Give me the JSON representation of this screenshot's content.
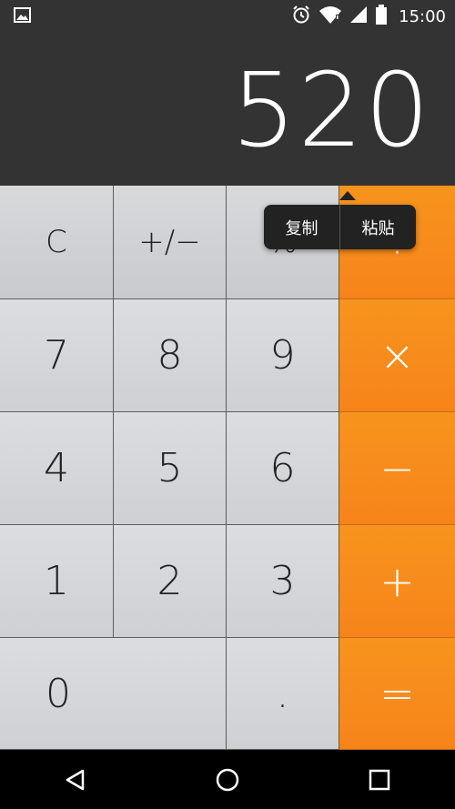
{
  "status_bar": {
    "time": "15:00",
    "icons": [
      "image-notification-icon",
      "alarm-icon",
      "wifi-icon",
      "signal-icon",
      "battery-icon"
    ]
  },
  "display": {
    "value": "520"
  },
  "popup": {
    "copy_label": "复制",
    "paste_label": "粘贴"
  },
  "keys": {
    "clear": "C",
    "plus_minus": "+∕−",
    "percent": "%",
    "divide": "÷",
    "seven": "7",
    "eight": "8",
    "nine": "9",
    "multiply": "×",
    "four": "4",
    "five": "5",
    "six": "6",
    "minus": "−",
    "one": "1",
    "two": "2",
    "three": "3",
    "plus": "+",
    "zero": "0",
    "dot": ".",
    "equals": "="
  },
  "colors": {
    "display_bg": "#333333",
    "accent_orange": "#f7941d",
    "key_gray": "#d2d3d6",
    "nav_bg": "#000000"
  },
  "nav_bar": {
    "icons": [
      "back-icon",
      "home-icon",
      "recents-icon"
    ]
  }
}
